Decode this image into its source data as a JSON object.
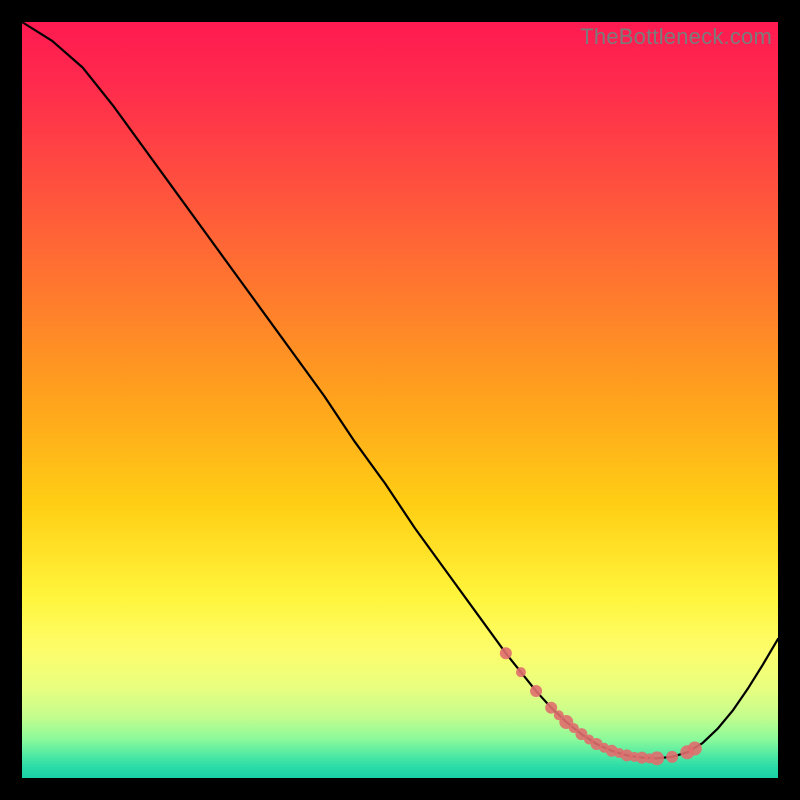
{
  "watermark": "TheBottleneck.com",
  "chart_data": {
    "type": "line",
    "title": "",
    "xlabel": "",
    "ylabel": "",
    "xlim": [
      0,
      100
    ],
    "ylim": [
      0,
      100
    ],
    "grid": false,
    "legend": false,
    "series": [
      {
        "name": "curve",
        "x": [
          0,
          4,
          8,
          12,
          16,
          20,
          24,
          28,
          32,
          36,
          40,
          44,
          48,
          52,
          56,
          60,
          64,
          68,
          70,
          72,
          74,
          76,
          78,
          80,
          82,
          84,
          86,
          88,
          90,
          92,
          94,
          96,
          98,
          100
        ],
        "y": [
          100,
          97.5,
          94,
          89,
          83.5,
          78,
          72.5,
          67,
          61.5,
          56,
          50.5,
          44.5,
          39,
          33,
          27.5,
          22,
          16.5,
          11.5,
          9.3,
          7.4,
          5.8,
          4.5,
          3.6,
          3.0,
          2.7,
          2.6,
          2.8,
          3.4,
          4.6,
          6.5,
          8.9,
          11.8,
          15.0,
          18.4
        ]
      }
    ],
    "markers": {
      "name": "highlighted-points",
      "x": [
        64,
        66,
        68,
        70,
        71,
        72,
        73,
        74,
        75,
        76,
        77,
        78,
        79,
        80,
        81,
        82,
        83,
        84,
        86,
        88,
        89
      ],
      "y": [
        16.5,
        14.0,
        11.5,
        9.3,
        8.3,
        7.4,
        6.6,
        5.8,
        5.1,
        4.5,
        4.0,
        3.6,
        3.3,
        3.0,
        2.8,
        2.7,
        2.6,
        2.6,
        2.8,
        3.4,
        3.9
      ],
      "radius": [
        6,
        5,
        6,
        6,
        5,
        7,
        5,
        6,
        5,
        6,
        5,
        6,
        5,
        6,
        5,
        6,
        5,
        7,
        6,
        7,
        7
      ]
    }
  }
}
